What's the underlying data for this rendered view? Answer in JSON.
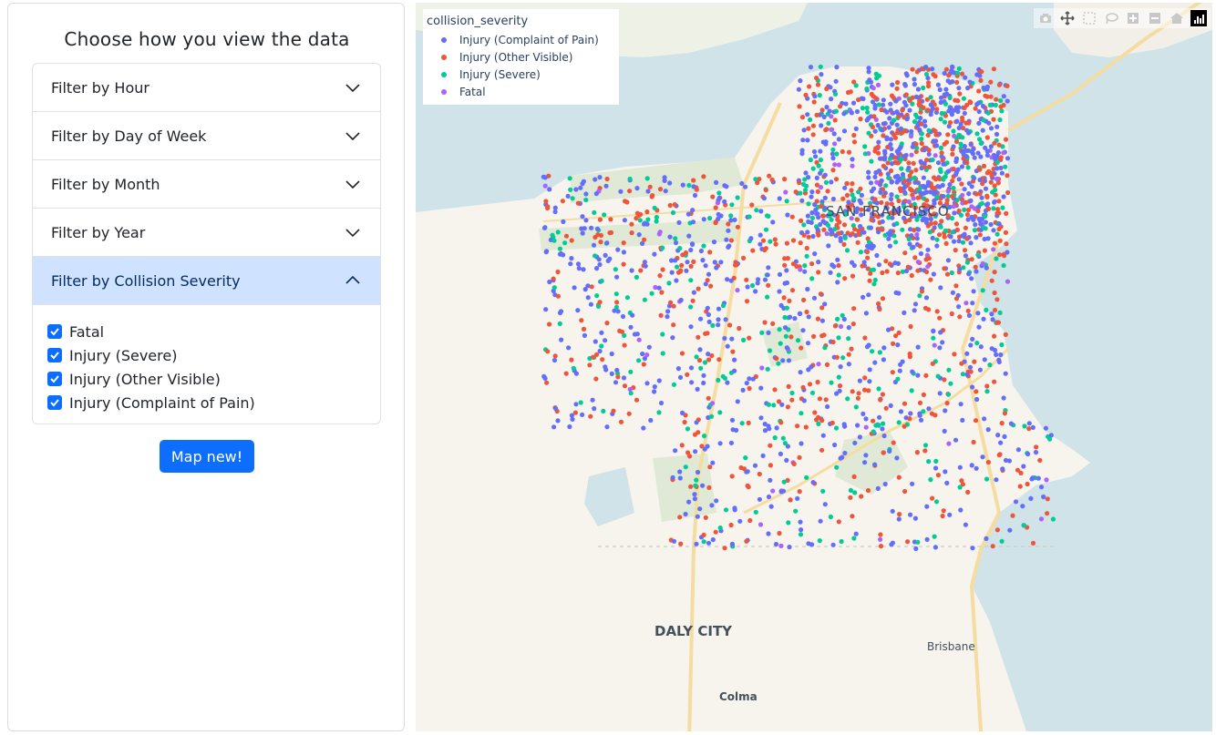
{
  "panel": {
    "title": "Choose how you view the data",
    "filters": [
      {
        "label": "Filter by Hour",
        "expanded": false
      },
      {
        "label": "Filter by Day of Week",
        "expanded": false
      },
      {
        "label": "Filter by Month",
        "expanded": false
      },
      {
        "label": "Filter by Year",
        "expanded": false
      },
      {
        "label": "Filter by Collision Severity",
        "expanded": true
      }
    ],
    "severity_options": [
      {
        "label": "Fatal",
        "checked": true
      },
      {
        "label": "Injury (Severe)",
        "checked": true
      },
      {
        "label": "Injury (Other Visible)",
        "checked": true
      },
      {
        "label": "Injury (Complaint of Pain)",
        "checked": true
      }
    ],
    "map_button": "Map new!"
  },
  "map": {
    "legend": {
      "title": "collision_severity",
      "items": [
        {
          "label": "Injury (Complaint of Pain)",
          "color": "#636efa"
        },
        {
          "label": "Injury (Other Visible)",
          "color": "#ef553b"
        },
        {
          "label": "Injury (Severe)",
          "color": "#00cc96"
        },
        {
          "label": "Fatal",
          "color": "#ab63fa"
        }
      ]
    },
    "places": {
      "city": "SAN FRANCISCO",
      "daly_city": "DALY CITY",
      "brisbane": "Brisbane",
      "colma": "Colma"
    },
    "modebar": [
      "camera-icon",
      "pan-icon",
      "box-select-icon",
      "lasso-icon",
      "zoom-in-icon",
      "zoom-out-icon",
      "home-icon",
      "plotly-logo"
    ],
    "colors": {
      "water": "#cfe3e8",
      "land": "#f7f4ee",
      "park": "#dfe9d6",
      "road": "#f5dca0"
    }
  }
}
